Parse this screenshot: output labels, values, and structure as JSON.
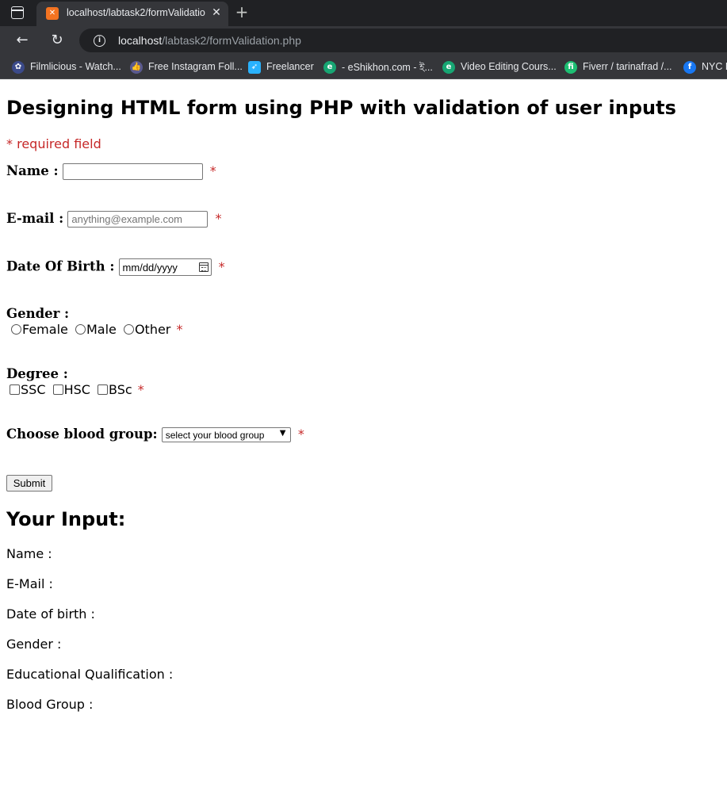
{
  "browser": {
    "tab_title": "localhost/labtask2/formValidatio",
    "url_host": "localhost",
    "url_path": "/labtask2/formValidation.php",
    "bookmarks": [
      {
        "label": "Filmlicious - Watch...",
        "icon": "filmlicious-icon",
        "color": "#3b4a8a"
      },
      {
        "label": "Free Instagram Foll...",
        "icon": "thumbs-up-icon",
        "color": "#5a5a8f"
      },
      {
        "label": "Freelancer",
        "icon": "freelancer-icon",
        "color": "#29b2fe"
      },
      {
        "label": "- eShikhon.com - ই...",
        "icon": "eshikhon-icon",
        "color": "#17a673"
      },
      {
        "label": "Video Editing Cours...",
        "icon": "video-course-icon",
        "color": "#17a673"
      },
      {
        "label": "Fiverr / tarinafrad /...",
        "icon": "fiverr-icon",
        "color": "#1dbf73"
      },
      {
        "label": "NYC B",
        "icon": "facebook-icon",
        "color": "#1877f2"
      }
    ]
  },
  "page": {
    "title": "Designing HTML form using PHP with validation of user inputs",
    "required_note": "* required field",
    "required_mark": "*"
  },
  "form": {
    "name_label": "Name :",
    "name_value": "",
    "email_label": "E-mail :",
    "email_placeholder": "anything@example.com",
    "dob_label": "Date Of Birth :",
    "dob_placeholder": "mm/dd/yyyy",
    "gender_label": "Gender :",
    "gender_options": [
      "Female",
      "Male",
      "Other"
    ],
    "degree_label": "Degree :",
    "degree_options": [
      "SSC",
      "HSC",
      "BSc"
    ],
    "blood_label": "Choose blood group:",
    "blood_selected": "select your blood group",
    "submit_label": "Submit"
  },
  "output": {
    "title": "Your Input:",
    "name": "Name :",
    "email": "E-Mail :",
    "dob": "Date of birth :",
    "gender": "Gender :",
    "education": "Educational Qualification :",
    "blood": "Blood Group :"
  },
  "colors": {
    "required": "#c62828",
    "favicon": "#f37321"
  }
}
